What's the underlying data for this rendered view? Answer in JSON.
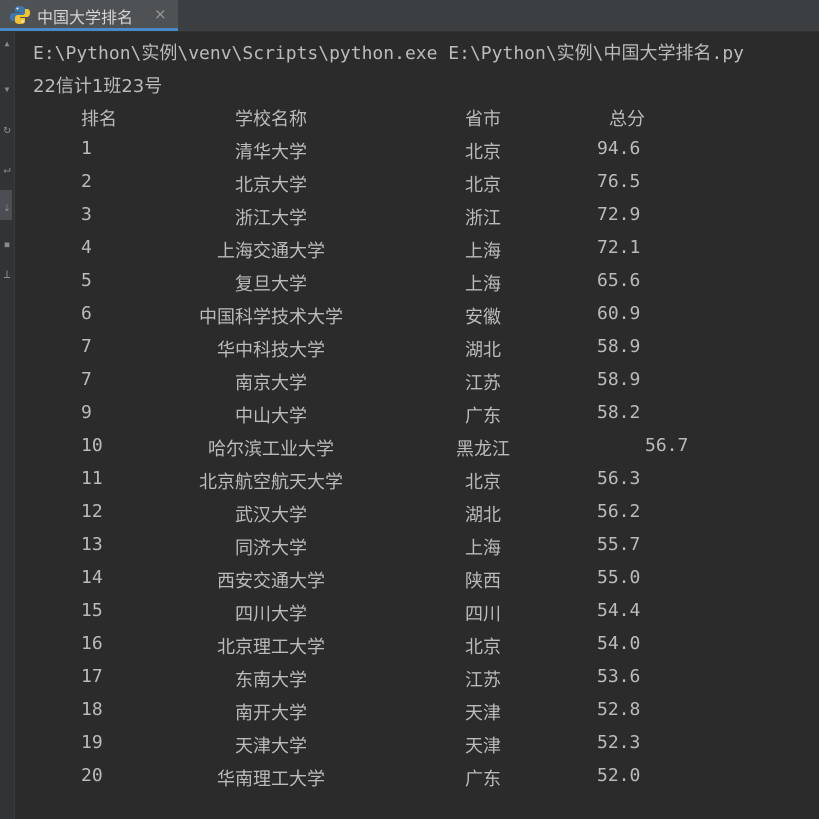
{
  "tab": {
    "title": "中国大学排名",
    "close_glyph": "×",
    "icon": "python-icon"
  },
  "console": {
    "command": "E:\\Python\\实例\\venv\\Scripts\\python.exe E:\\Python\\实例\\中国大学排名.py",
    "author": "22信计1班23号",
    "headers": {
      "rank": "排名",
      "name": "学校名称",
      "province": "省市",
      "score": "总分"
    },
    "rows": [
      {
        "rank": "1",
        "name": "清华大学",
        "province": "北京",
        "score": "94.6"
      },
      {
        "rank": "2",
        "name": "北京大学",
        "province": "北京",
        "score": "76.5"
      },
      {
        "rank": "3",
        "name": "浙江大学",
        "province": "浙江",
        "score": "72.9"
      },
      {
        "rank": "4",
        "name": "上海交通大学",
        "province": "上海",
        "score": "72.1"
      },
      {
        "rank": "5",
        "name": "复旦大学",
        "province": "上海",
        "score": "65.6"
      },
      {
        "rank": "6",
        "name": "中国科学技术大学",
        "province": "安徽",
        "score": "60.9"
      },
      {
        "rank": "7",
        "name": "华中科技大学",
        "province": "湖北",
        "score": "58.9"
      },
      {
        "rank": "7",
        "name": "南京大学",
        "province": "江苏",
        "score": "58.9"
      },
      {
        "rank": "9",
        "name": "中山大学",
        "province": "广东",
        "score": "58.2"
      },
      {
        "rank": "10",
        "name": "哈尔滨工业大学",
        "province": "黑龙江",
        "score": "56.7"
      },
      {
        "rank": "11",
        "name": "北京航空航天大学",
        "province": "北京",
        "score": "56.3"
      },
      {
        "rank": "12",
        "name": "武汉大学",
        "province": "湖北",
        "score": "56.2"
      },
      {
        "rank": "13",
        "name": "同济大学",
        "province": "上海",
        "score": "55.7"
      },
      {
        "rank": "14",
        "name": "西安交通大学",
        "province": "陕西",
        "score": "55.0"
      },
      {
        "rank": "15",
        "name": "四川大学",
        "province": "四川",
        "score": "54.4"
      },
      {
        "rank": "16",
        "name": "北京理工大学",
        "province": "北京",
        "score": "54.0"
      },
      {
        "rank": "17",
        "name": "东南大学",
        "province": "江苏",
        "score": "53.6"
      },
      {
        "rank": "18",
        "name": "南开大学",
        "province": "天津",
        "score": "52.8"
      },
      {
        "rank": "19",
        "name": "天津大学",
        "province": "天津",
        "score": "52.3"
      },
      {
        "rank": "20",
        "name": "华南理工大学",
        "province": "广东",
        "score": "52.0"
      }
    ]
  },
  "colors": {
    "background": "#2b2b2b",
    "text": "#bbbbbb",
    "tab_accent": "#4a88c7"
  }
}
